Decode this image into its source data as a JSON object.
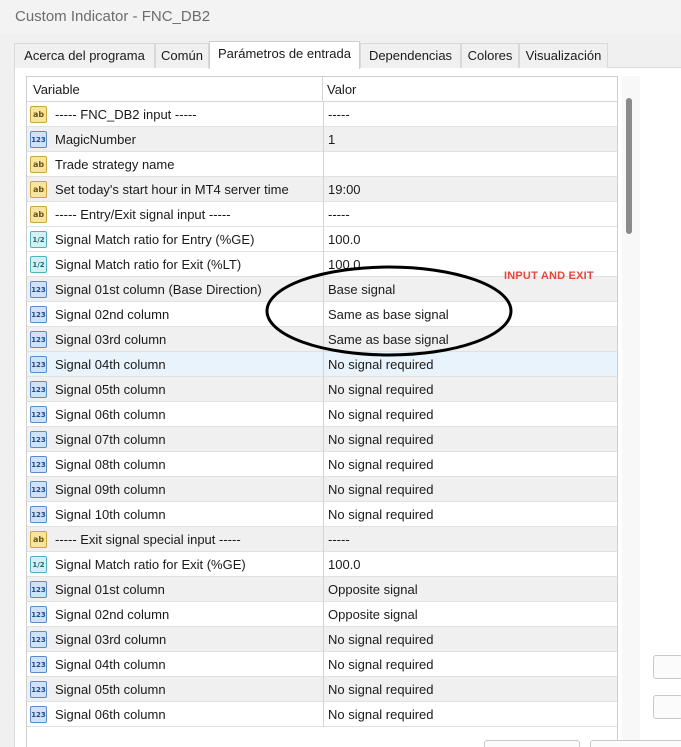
{
  "window": {
    "title": "Custom Indicator - FNC_DB2"
  },
  "tabs": [
    {
      "label": "Acerca del programa"
    },
    {
      "label": "Común"
    },
    {
      "label": "Parámetros de entrada"
    },
    {
      "label": "Dependencias"
    },
    {
      "label": "Colores"
    },
    {
      "label": "Visualización"
    }
  ],
  "grid": {
    "columns": {
      "variable": "Variable",
      "value": "Valor"
    },
    "rows": [
      {
        "icon": "ab",
        "name": "----- FNC_DB2 input -----",
        "value": "-----"
      },
      {
        "icon": "123",
        "name": "MagicNumber",
        "value": "1"
      },
      {
        "icon": "ab",
        "name": "Trade strategy name",
        "value": ""
      },
      {
        "icon": "ab",
        "name": "Set today's start hour in MT4 server time",
        "value": "19:00"
      },
      {
        "icon": "ab",
        "name": "----- Entry/Exit signal input -----",
        "value": "-----"
      },
      {
        "icon": "1/2",
        "name": "Signal Match ratio for Entry (%GE)",
        "value": "100.0"
      },
      {
        "icon": "1/2",
        "name": "Signal Match ratio for Exit (%LT)",
        "value": "100.0"
      },
      {
        "icon": "123",
        "name": "Signal 01st column (Base Direction)",
        "value": "Base signal"
      },
      {
        "icon": "123",
        "name": "Signal 02nd column",
        "value": "Same as base signal"
      },
      {
        "icon": "123",
        "name": "Signal 03rd column",
        "value": "Same as base signal"
      },
      {
        "icon": "123",
        "name": "Signal 04th column",
        "value": "No signal required"
      },
      {
        "icon": "123",
        "name": "Signal 05th column",
        "value": "No signal required"
      },
      {
        "icon": "123",
        "name": "Signal 06th column",
        "value": "No signal required"
      },
      {
        "icon": "123",
        "name": "Signal 07th column",
        "value": "No signal required"
      },
      {
        "icon": "123",
        "name": "Signal 08th column",
        "value": "No signal required"
      },
      {
        "icon": "123",
        "name": "Signal 09th column",
        "value": "No signal required"
      },
      {
        "icon": "123",
        "name": "Signal 10th column",
        "value": "No signal required"
      },
      {
        "icon": "ab",
        "name": "----- Exit signal special input -----",
        "value": "-----"
      },
      {
        "icon": "1/2",
        "name": "Signal Match ratio for Exit (%GE)",
        "value": "100.0"
      },
      {
        "icon": "123",
        "name": "Signal 01st column",
        "value": "Opposite signal"
      },
      {
        "icon": "123",
        "name": "Signal 02nd column",
        "value": "Opposite signal"
      },
      {
        "icon": "123",
        "name": "Signal 03rd column",
        "value": "No signal required"
      },
      {
        "icon": "123",
        "name": "Signal 04th column",
        "value": "No signal required"
      },
      {
        "icon": "123",
        "name": "Signal 05th column",
        "value": "No signal required"
      },
      {
        "icon": "123",
        "name": "Signal 06th column",
        "value": "No signal required"
      }
    ]
  },
  "annotation": {
    "text": "INPUT AND EXIT",
    "color": "#e8463c"
  }
}
